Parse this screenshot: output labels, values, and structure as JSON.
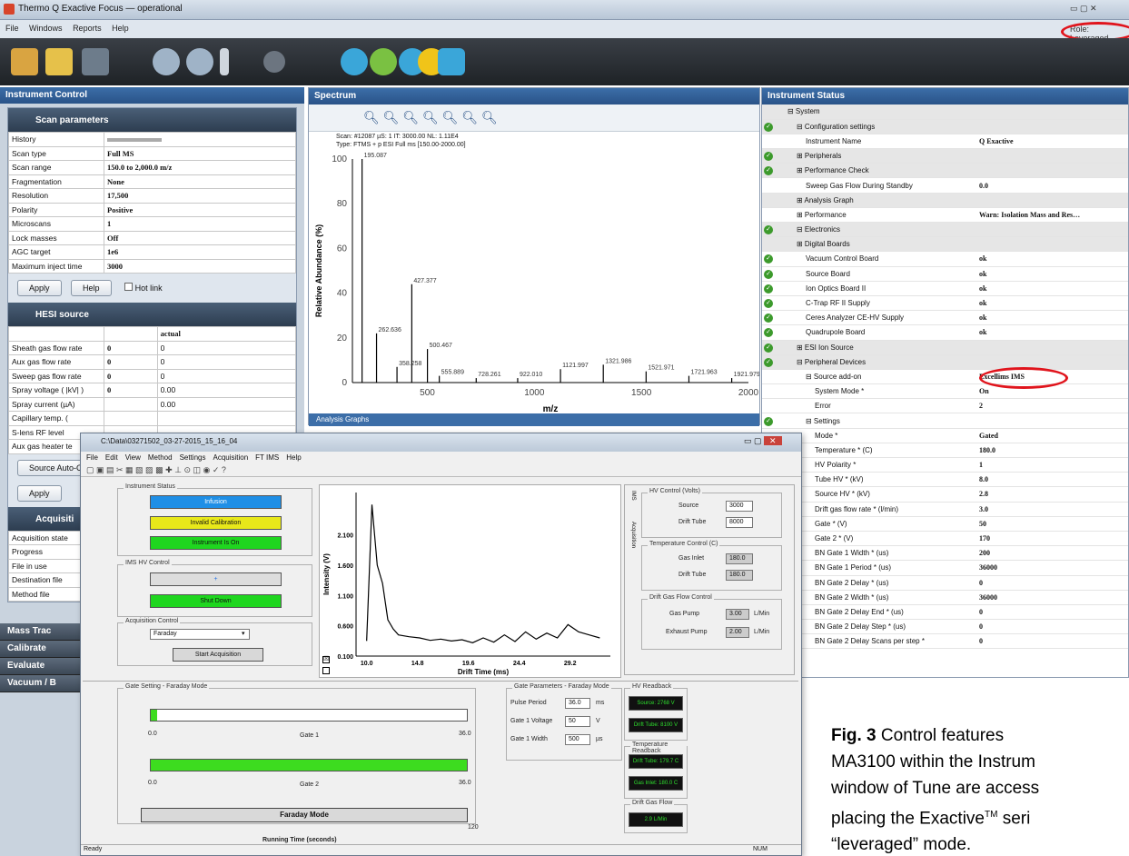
{
  "window": {
    "title": "Thermo Q Exactive Focus — operational",
    "role": "Role: Leveraged"
  },
  "menu": [
    "File",
    "Windows",
    "Reports",
    "Help"
  ],
  "instrument_control": {
    "title": "Instrument Control",
    "scan_section": "Scan parameters",
    "scan_rows": [
      [
        "History",
        ""
      ],
      [
        "Scan type",
        "Full MS"
      ],
      [
        "Scan range",
        "150.0 to 2,000.0 m/z"
      ],
      [
        "Fragmentation",
        "None"
      ],
      [
        "Resolution",
        "17,500"
      ],
      [
        "Polarity",
        "Positive"
      ],
      [
        "Microscans",
        "1"
      ],
      [
        "Lock masses",
        "Off"
      ],
      [
        "AGC target",
        "1e6"
      ],
      [
        "Maximum inject time",
        "3000"
      ]
    ],
    "apply": "Apply",
    "help": "Help",
    "hotlink": "Hot link",
    "hesi_section": "HESI source",
    "hesi_col": "actual",
    "hesi_rows": [
      [
        "Sheath gas flow rate",
        "0",
        "0"
      ],
      [
        "Aux gas flow rate",
        "0",
        "0"
      ],
      [
        "Sweep gas flow rate",
        "0",
        "0"
      ],
      [
        "Spray voltage ( |kV| )",
        "0",
        "0.00"
      ],
      [
        "Spray current (µA)",
        "",
        "0.00"
      ],
      [
        "Capillary temp. (",
        "",
        ""
      ],
      [
        "S-lens RF level",
        "",
        ""
      ],
      [
        "Aux gas heater te",
        "",
        ""
      ]
    ],
    "source_auto": "Source Auto-C",
    "apply2": "Apply",
    "acq_section": "Acquisiti",
    "acq_rows": [
      "Acquisition state",
      "Progress",
      "File in use",
      "Destination file",
      "Method file"
    ],
    "nav": [
      "Mass Trac",
      "Calibrate",
      "Evaluate",
      "Vacuum / B"
    ]
  },
  "spectrum": {
    "title": "Spectrum",
    "header1": "Scan: #12087   µS: 1   IT: 3000.00   NL: 1.11E4",
    "header2": "Type: FTMS + p ESI Full ms [150.00-2000.00]",
    "analysis_graph": "Analysis Graphs"
  },
  "chart_data": [
    {
      "type": "bar",
      "xlabel": "m/z",
      "ylabel": "Relative Abundance (%)",
      "xlim": [
        150,
        2000
      ],
      "ylim": [
        0,
        100
      ],
      "xticks": [
        500,
        1000,
        1500,
        2000
      ],
      "yticks": [
        0,
        20,
        40,
        60,
        80,
        100
      ],
      "peaks": [
        {
          "mz": 195.087,
          "rel": 100,
          "label": "195.087"
        },
        {
          "mz": 262.636,
          "rel": 22,
          "label": "262.636"
        },
        {
          "mz": 358.258,
          "rel": 7,
          "label": "358.258"
        },
        {
          "mz": 427.377,
          "rel": 44,
          "label": "427.377"
        },
        {
          "mz": 500.467,
          "rel": 15,
          "label": "500.467"
        },
        {
          "mz": 555.889,
          "rel": 3,
          "label": "555.889"
        },
        {
          "mz": 728.261,
          "rel": 2,
          "label": "728.261"
        },
        {
          "mz": 922.01,
          "rel": 2,
          "label": "922.010"
        },
        {
          "mz": 1121.997,
          "rel": 6,
          "label": "1121.997"
        },
        {
          "mz": 1321.986,
          "rel": 8,
          "label": "1321.986"
        },
        {
          "mz": 1521.971,
          "rel": 5,
          "label": "1521.971"
        },
        {
          "mz": 1721.963,
          "rel": 3,
          "label": "1721.963"
        },
        {
          "mz": 1921.979,
          "rel": 2,
          "label": "1921.979"
        }
      ]
    },
    {
      "type": "line",
      "xlabel": "Drift Time (ms)",
      "ylabel": "Intensity (V)",
      "xticks": [
        "10.0",
        "14.8",
        "19.6",
        "24.4",
        "29.2"
      ],
      "yticks": [
        "0.100",
        "0.600",
        "1.100",
        "1.600",
        "2.100"
      ],
      "x": [
        10.0,
        10.5,
        11.0,
        11.5,
        12.0,
        12.5,
        13.0,
        14.0,
        15.0,
        16.0,
        17.0,
        18.0,
        19.0,
        20.0,
        21.0,
        22.0,
        23.0,
        24.0,
        25.0,
        26.0,
        27.0,
        28.0,
        29.0,
        30.0,
        31.0,
        32.0
      ],
      "y": [
        0.35,
        2.6,
        1.6,
        1.3,
        0.7,
        0.55,
        0.45,
        0.42,
        0.4,
        0.36,
        0.38,
        0.35,
        0.37,
        0.32,
        0.4,
        0.33,
        0.45,
        0.34,
        0.5,
        0.38,
        0.48,
        0.4,
        0.62,
        0.5,
        0.45,
        0.4
      ]
    }
  ],
  "instrument_status": {
    "title": "Instrument Status",
    "rows": [
      [
        "",
        "⊟ System",
        ""
      ],
      [
        "ok",
        "⊟ Configuration settings",
        ""
      ],
      [
        "",
        "Instrument Name",
        "Q Exactive"
      ],
      [
        "ok",
        "⊞ Peripherals",
        ""
      ],
      [
        "ok",
        "⊞ Performance Check",
        ""
      ],
      [
        "",
        "Sweep Gas Flow During Standby",
        "0.0"
      ],
      [
        "",
        "⊞ Analysis Graph",
        ""
      ],
      [
        "",
        "⊞ Performance",
        "Warn: Isolation Mass and Res…"
      ],
      [
        "ok",
        "⊟ Electronics",
        ""
      ],
      [
        "",
        "⊞ Digital Boards",
        ""
      ],
      [
        "ok",
        "Vacuum Control Board",
        "ok"
      ],
      [
        "ok",
        "Source Board",
        "ok"
      ],
      [
        "ok",
        "Ion Optics Board II",
        "ok"
      ],
      [
        "ok",
        "C-Trap RF II Supply",
        "ok"
      ],
      [
        "ok",
        "Ceres Analyzer CE-HV Supply",
        "ok"
      ],
      [
        "ok",
        "Quadrupole Board",
        "ok"
      ],
      [
        "ok",
        "⊞ ESI Ion Source",
        ""
      ],
      [
        "ok",
        "⊟ Peripheral Devices",
        ""
      ],
      [
        "",
        "⊟ Source add-on",
        "Excellims IMS"
      ],
      [
        "",
        "System Mode *",
        "On"
      ],
      [
        "",
        "Error",
        "2"
      ],
      [
        "ok",
        "⊟ Settings",
        ""
      ],
      [
        "",
        "Mode *",
        "Gated"
      ],
      [
        "",
        "Temperature * (C)",
        "180.0"
      ],
      [
        "",
        "HV Polarity *",
        "1"
      ],
      [
        "",
        "Tube HV * (kV)",
        "8.0"
      ],
      [
        "",
        "Source HV * (kV)",
        "2.8"
      ],
      [
        "",
        "Drift gas flow rate * (l/min)",
        "3.0"
      ],
      [
        "",
        "Gate * (V)",
        "50"
      ],
      [
        "",
        "Gate 2 * (V)",
        "170"
      ],
      [
        "",
        "BN Gate 1 Width * (us)",
        "200"
      ],
      [
        "",
        "BN Gate 1 Period * (us)",
        "36000"
      ],
      [
        "",
        "BN Gate 2 Delay * (us)",
        "0"
      ],
      [
        "",
        "BN Gate 2 Width * (us)",
        "36000"
      ],
      [
        "",
        "BN Gate 2 Delay End * (us)",
        "0"
      ],
      [
        "",
        "BN Gate 2 Delay Step * (us)",
        "0"
      ],
      [
        "",
        "BN Gate 2 Delay Scans per step *",
        "0"
      ]
    ]
  },
  "ims": {
    "title": "C:\\Data\\03271502_03-27-2015_15_16_04",
    "menu": [
      "File",
      "Edit",
      "View",
      "Method",
      "Settings",
      "Acquisition",
      "FT IMS",
      "Help"
    ],
    "status_group": "Instrument Status",
    "btn_infusion": "Infusion",
    "btn_invalid": "Invalid Calibration",
    "btn_instrument": "Instrument Is On",
    "hv_group": "IMS HV Control",
    "btn_plus": "+",
    "btn_shutdown": "Shut Down",
    "acq_group": "Acquisition Control",
    "acq_select": "Faraday",
    "btn_start": "Start Acquisition",
    "tab_ims": "IMS",
    "tab_acq": "Acquisition",
    "hv_ctrl": "HV Control (Volts)",
    "source_l": "Source",
    "source_v": "3000",
    "drift_l": "Drift Tube",
    "drift_v": "8000",
    "temp_ctrl": "Temperature Control (C)",
    "gasinlet_l": "Gas Inlet",
    "gasinlet_v": "180.0",
    "drifttube_l": "Drift Tube",
    "drifttube_v": "180.0",
    "flow_ctrl": "Drift Gas Flow Control",
    "gaspump_l": "Gas Pump",
    "gaspump_v": "3.00",
    "unit1": "L/Min",
    "exhaust_l": "Exhaust Pump",
    "exhaust_v": "2.00",
    "unit2": "L/Min",
    "gate_group": "Gate Setting - Faraday Mode",
    "gate1": "Gate 1",
    "gate2": "Gate 2",
    "slider_min": "0.0",
    "slider_max": "36.0",
    "gate1_fill": 0.02,
    "gate2_fill": 1.0,
    "faraday": "Faraday Mode",
    "running": "Running Time (seconds)",
    "running_max": "120",
    "params_group": "Gate Parameters - Faraday Mode",
    "pulse_l": "Pulse Period",
    "pulse_v": "36.0",
    "pulse_u": "ms",
    "g1v_l": "Gate 1 Voltage",
    "g1v_v": "50",
    "g1v_u": "V",
    "g1w_l": "Gate 1 Width",
    "g1w_v": "500",
    "g1w_u": "µs",
    "hv_read": "HV Readback",
    "hv_src": "Source: 2768 V",
    "hv_drift": "Drift Tube: 8100 V",
    "temp_read": "Temperature Readback",
    "t_drift": "Drift Tube: 179.7 C",
    "t_gas": "Gas Inlet: 180.0 C",
    "flow_read": "Drift Gas Flow",
    "flow_v": "2.9 L/Min",
    "statusbar": "Ready",
    "num": "NUM"
  },
  "caption": {
    "line1_bold": "Fig. 3",
    "line1": " Control features",
    "line2": "MA3100 within the Instrum",
    "line3": "window of Tune are access",
    "line4a": "placing the Exactive",
    "line4sup": "TM",
    "line4b": " seri",
    "line5": "“leveraged” mode."
  }
}
